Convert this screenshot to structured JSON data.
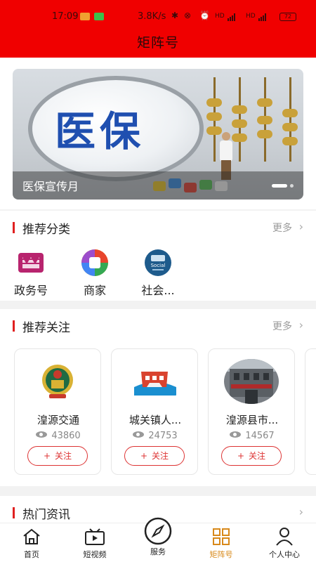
{
  "status_bar": {
    "time": "17:09",
    "speed": "3.8K/s",
    "battery": "72"
  },
  "header": {
    "title": "矩阵号"
  },
  "banner": {
    "image_text": "医保",
    "caption": "医保宣传月",
    "active_dot": 0,
    "dot_count": 2
  },
  "recommend_categories": {
    "title": "推荐分类",
    "more": "更多",
    "items": [
      {
        "label": "政务号",
        "icon": "government-icon"
      },
      {
        "label": "商家",
        "icon": "merchant-icon"
      },
      {
        "label": "社会...",
        "icon": "social-icon"
      }
    ]
  },
  "recommend_follows": {
    "title": "推荐关注",
    "more": "更多",
    "follow_label": "关注",
    "items": [
      {
        "name": "湟源交通",
        "views": "43860",
        "avatar": "traffic-emblem-icon"
      },
      {
        "name": "城关镇人...",
        "views": "24753",
        "avatar": "town-logo-icon"
      },
      {
        "name": "湟源县市...",
        "views": "14567",
        "avatar": "building-photo-icon"
      }
    ]
  },
  "hot_news": {
    "title": "热门资讯"
  },
  "tabbar": {
    "items": [
      {
        "label": "首页",
        "icon": "home-icon"
      },
      {
        "label": "短视频",
        "icon": "video-icon"
      },
      {
        "label": "服务",
        "icon": "compass-icon"
      },
      {
        "label": "矩阵号",
        "icon": "grid-icon",
        "active": true
      },
      {
        "label": "个人中心",
        "icon": "user-icon"
      }
    ]
  },
  "colors": {
    "brand_red": "#f00000",
    "accent_bar": "#e02020",
    "active_tab": "#d8891a"
  }
}
